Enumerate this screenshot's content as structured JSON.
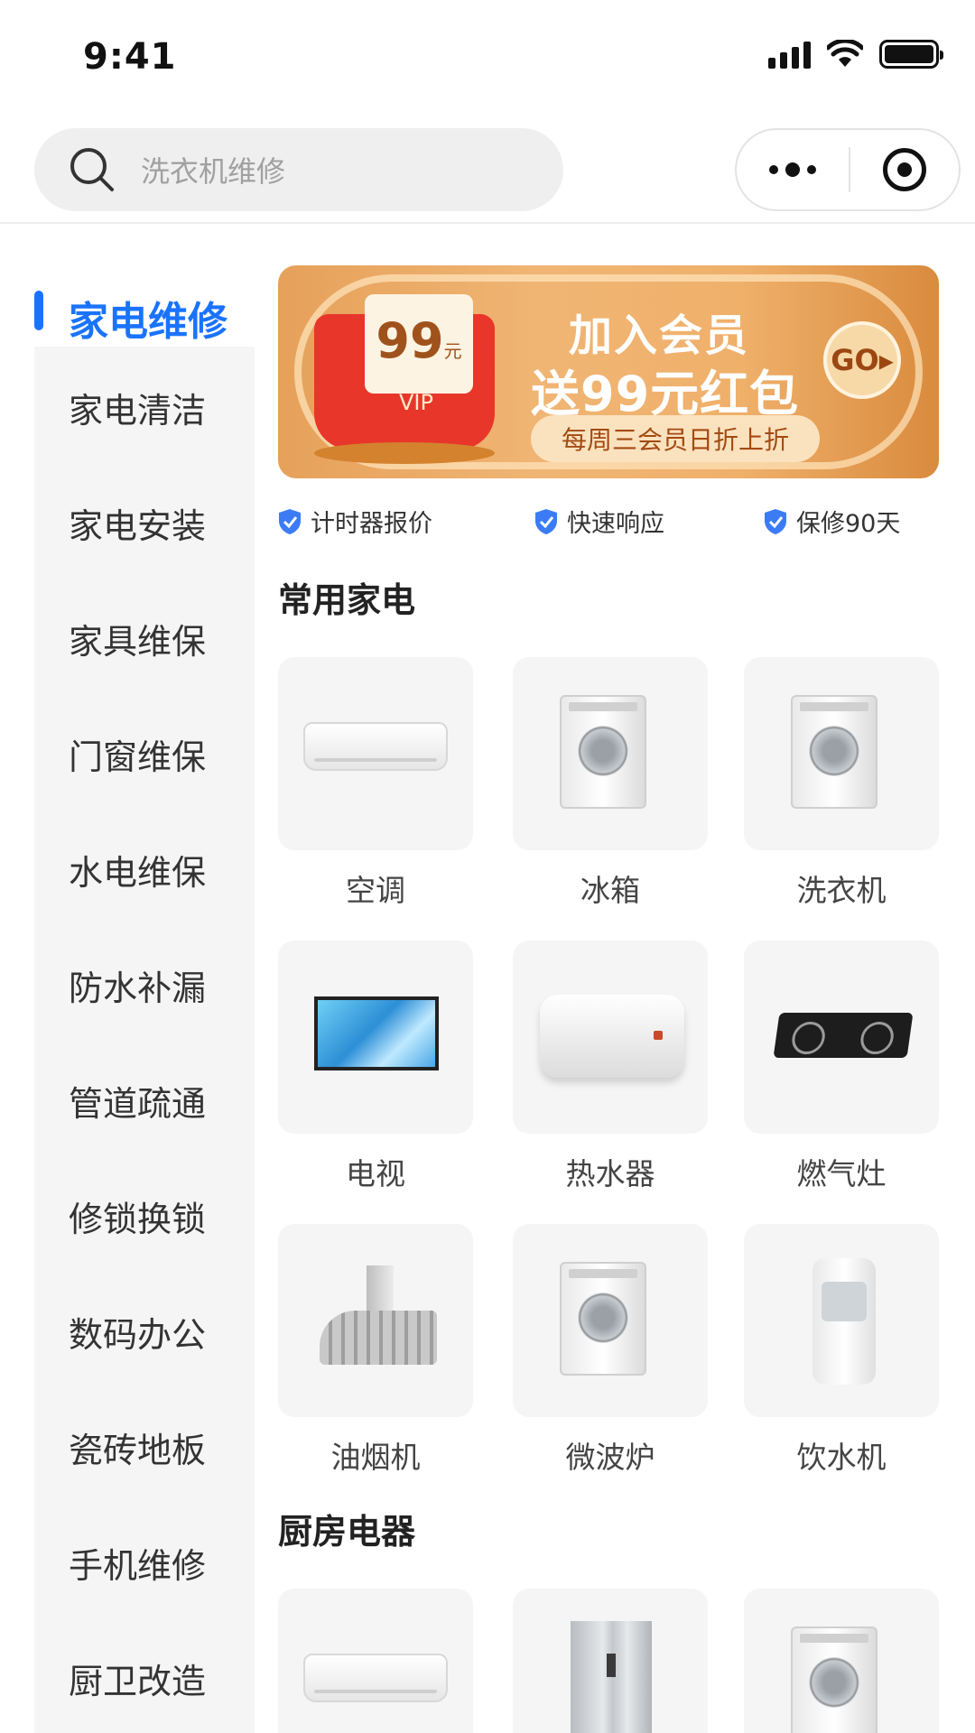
{
  "status_bar": {
    "time": "9:41"
  },
  "search": {
    "placeholder": "洗衣机维修"
  },
  "sidebar": {
    "active": "家电维修",
    "items": [
      "家电清洁",
      "家电安装",
      "家具维保",
      "门窗维保",
      "水电维保",
      "防水补漏",
      "管道疏通",
      "修锁换锁",
      "数码办公",
      "瓷砖地板",
      "手机维修",
      "厨卫改造"
    ]
  },
  "banner": {
    "amount": "99",
    "unit": "元",
    "vip": "VIP",
    "title_line1": "加入会员",
    "title_line2": "送99元红包",
    "subtitle": "每周三会员日折上折",
    "go": "GO"
  },
  "features": [
    "计时器报价",
    "快速响应",
    "保修90天"
  ],
  "sections": [
    {
      "title": "常用家电",
      "items": [
        {
          "label": "空调",
          "icon": "air-conditioner-icon"
        },
        {
          "label": "冰箱",
          "icon": "washer-icon"
        },
        {
          "label": "洗衣机",
          "icon": "washer-icon"
        },
        {
          "label": "电视",
          "icon": "tv-icon"
        },
        {
          "label": "热水器",
          "icon": "water-heater-icon"
        },
        {
          "label": "燃气灶",
          "icon": "gas-stove-icon"
        },
        {
          "label": "油烟机",
          "icon": "range-hood-icon"
        },
        {
          "label": "微波炉",
          "icon": "washer-icon"
        },
        {
          "label": "饮水机",
          "icon": "water-dispenser-icon"
        }
      ]
    },
    {
      "title": "厨房电器",
      "items": [
        {
          "label": "",
          "icon": "air-conditioner-icon"
        },
        {
          "label": "",
          "icon": "refrigerator-icon"
        },
        {
          "label": "",
          "icon": "washer-icon"
        }
      ]
    }
  ],
  "colors": {
    "accent": "#1a73ff",
    "sidebar_bg": "#f5f5f5",
    "tile_bg": "#f5f5f5"
  }
}
